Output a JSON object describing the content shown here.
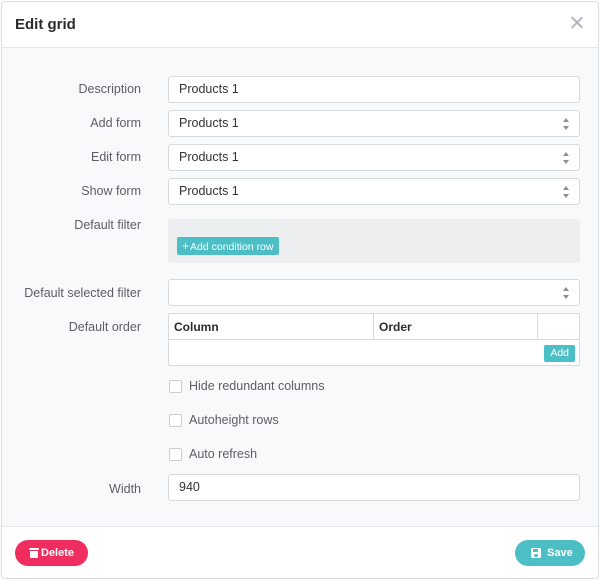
{
  "dialog": {
    "title": "Edit grid"
  },
  "fields": {
    "description": {
      "label": "Description",
      "value": "Products 1"
    },
    "add_form": {
      "label": "Add form",
      "value": "Products 1"
    },
    "edit_form": {
      "label": "Edit form",
      "value": "Products 1"
    },
    "show_form": {
      "label": "Show form",
      "value": "Products 1"
    },
    "default_filter": {
      "label": "Default filter",
      "add_button": "Add condition row"
    },
    "default_selected_filter": {
      "label": "Default selected filter",
      "value": ""
    },
    "default_order": {
      "label": "Default order",
      "columns": [
        "Column",
        "Order"
      ],
      "add_button": "Add"
    },
    "hide_redundant": {
      "label": "Hide redundant columns",
      "checked": false
    },
    "autoheight": {
      "label": "Autoheight rows",
      "checked": false
    },
    "auto_refresh": {
      "label": "Auto refresh",
      "checked": false
    },
    "width": {
      "label": "Width",
      "value": "940"
    }
  },
  "footer": {
    "delete_label": "Delete",
    "save_label": "Save"
  },
  "icons": {
    "close": "close-icon",
    "delete": "trash-icon",
    "save": "save-icon",
    "add": "plus-icon",
    "select": "select-arrows-icon"
  },
  "colors": {
    "primary": "#4bbfc5",
    "danger": "#ef2d5e"
  }
}
